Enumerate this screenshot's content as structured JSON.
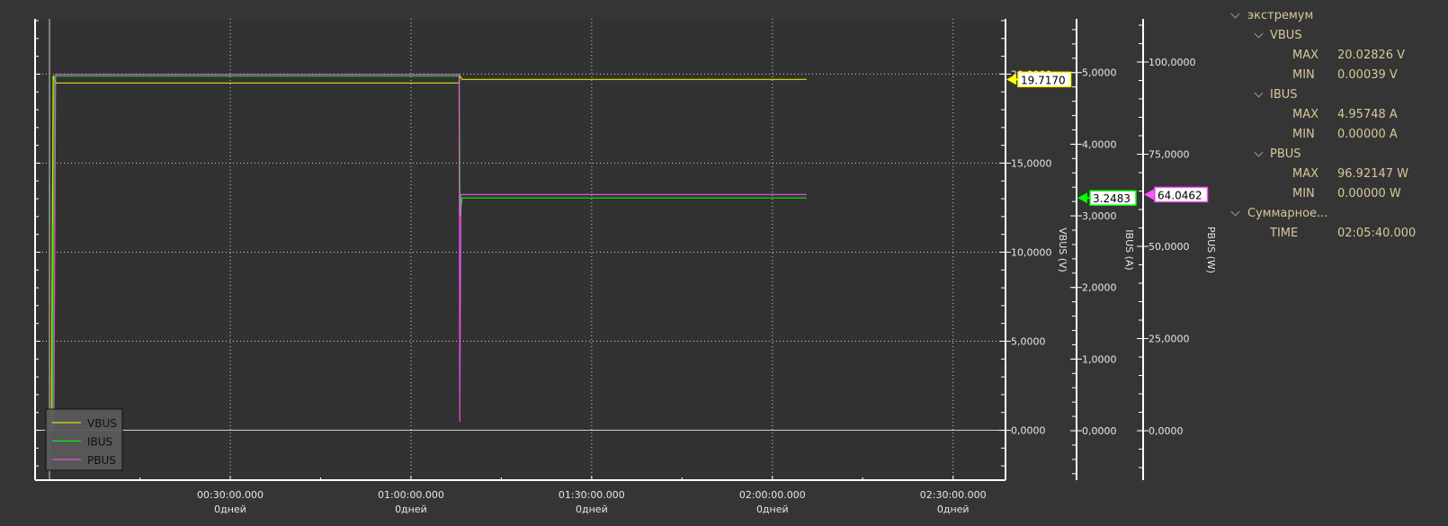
{
  "chart_data": {
    "type": "line",
    "x_unit": "minutes",
    "xlim": [
      -2.4,
      158.7
    ],
    "x_ticks": [
      {
        "value": 30,
        "time": "00:30:00.000",
        "days": "0дней"
      },
      {
        "value": 60,
        "time": "01:00:00.000",
        "days": "0дней"
      },
      {
        "value": 90,
        "time": "01:30:00.000",
        "days": "0дней"
      },
      {
        "value": 120,
        "time": "02:00:00.000",
        "days": "0дней"
      },
      {
        "value": 150,
        "time": "02:30:00.000",
        "days": "0дней"
      }
    ],
    "grid": true,
    "legend": {
      "position": "bottom-left",
      "entries": [
        "VBUS",
        "IBUS",
        "PBUS"
      ]
    },
    "axes": [
      {
        "id": "vbus",
        "label": "VBUS (V)",
        "ylim": [
          -2.8,
          23.1
        ],
        "ticks": [
          0,
          5,
          10,
          15,
          20
        ],
        "tick_labels": [
          "0,0000",
          "5,0000",
          "10,0000",
          "15,0000",
          "20,0000"
        ],
        "minor": 1
      },
      {
        "id": "ibus",
        "label": "IBUS (A)",
        "ylim": [
          -0.69,
          5.75
        ],
        "ticks": [
          0,
          1,
          2,
          3,
          4,
          5
        ],
        "tick_labels": [
          "0,0000",
          "1,0000",
          "2,0000",
          "3,0000",
          "4,0000",
          "5,0000"
        ],
        "minor": 0.2
      },
      {
        "id": "pbus",
        "label": "PBUS (W)",
        "ylim": [
          -13.4,
          111.7
        ],
        "ticks": [
          0,
          25,
          50,
          75,
          100
        ],
        "tick_labels": [
          "0,0000",
          "25,0000",
          "50,0000",
          "75,0000",
          "100,0000"
        ],
        "minor": 5
      }
    ],
    "series": [
      {
        "name": "VBUS",
        "axis": "vbus",
        "color": "#ffff00",
        "points": [
          [
            0.3,
            0.0
          ],
          [
            0.6,
            19.9
          ],
          [
            1.0,
            19.5
          ],
          [
            68.0,
            19.5
          ],
          [
            68.1,
            19.9
          ],
          [
            68.5,
            19.7
          ],
          [
            125.67,
            19.7
          ]
        ],
        "marker": "19.7170"
      },
      {
        "name": "IBUS",
        "axis": "ibus",
        "color": "#00ff00",
        "points": [
          [
            0.5,
            0.0
          ],
          [
            0.8,
            4.95
          ],
          [
            68.0,
            4.95
          ],
          [
            68.15,
            3.0
          ],
          [
            68.5,
            3.25
          ],
          [
            125.67,
            3.25
          ]
        ],
        "marker": "3.2483"
      },
      {
        "name": "PBUS",
        "axis": "pbus",
        "color": "#ff55ff",
        "points": [
          [
            0.7,
            0.0
          ],
          [
            1.0,
            96.6
          ],
          [
            68.0,
            96.6
          ],
          [
            68.1,
            2.4
          ],
          [
            68.3,
            64.05
          ],
          [
            125.67,
            64.05
          ]
        ],
        "marker": "64.0462"
      }
    ]
  },
  "tree": {
    "group1": "экстремум",
    "vbus": {
      "label": "VBUS",
      "max_label": "MAX",
      "max": "20.02826 V",
      "min_label": "MIN",
      "min": "0.00039 V"
    },
    "ibus": {
      "label": "IBUS",
      "max_label": "MAX",
      "max": "4.95748 A",
      "min_label": "MIN",
      "min": "0.00000 A"
    },
    "pbus": {
      "label": "PBUS",
      "max_label": "MAX",
      "max": "96.92147 W",
      "min_label": "MIN",
      "min": "0.00000 W"
    },
    "group2": "Суммарное...",
    "time_label": "TIME",
    "time": "02:05:40.000"
  }
}
